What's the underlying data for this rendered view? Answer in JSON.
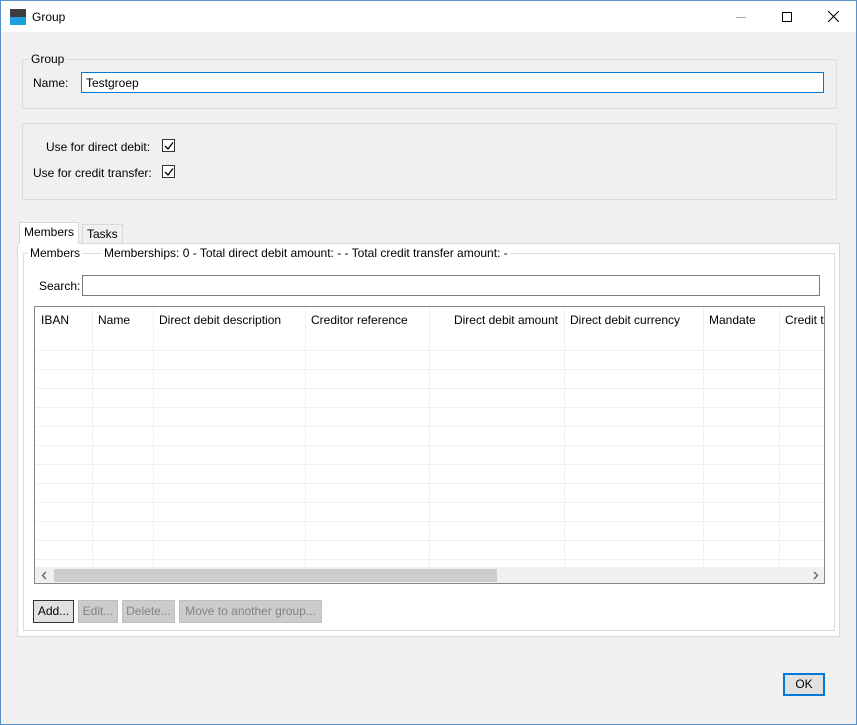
{
  "window": {
    "title": "Group",
    "controls": [
      "minimize",
      "maximize",
      "close"
    ]
  },
  "group_box": {
    "legend": "Group",
    "name_label": "Name:",
    "name_value": "Testgroep"
  },
  "options": {
    "direct_debit_label": "Use for direct debit:",
    "direct_debit_checked": true,
    "credit_transfer_label": "Use for credit transfer:",
    "credit_transfer_checked": true
  },
  "tabs": [
    {
      "label": "Members",
      "active": true
    },
    {
      "label": "Tasks",
      "active": false
    }
  ],
  "members": {
    "legend": "Members",
    "summary": "Memberships: 0 - Total direct debit amount: - - Total credit transfer amount: -",
    "search_label": "Search:",
    "search_value": "",
    "columns": [
      "IBAN",
      "Name",
      "Direct debit description",
      "Creditor reference",
      "Direct debit amount",
      "Direct debit currency",
      "Mandate",
      "Credit t"
    ],
    "rows": []
  },
  "actions": {
    "add": "Add...",
    "edit": "Edit...",
    "delete": "Delete...",
    "move": "Move to another group..."
  },
  "footer": {
    "ok": "OK"
  },
  "colors": {
    "accent": "#0078d7",
    "window_bg": "#f0f0f0"
  }
}
